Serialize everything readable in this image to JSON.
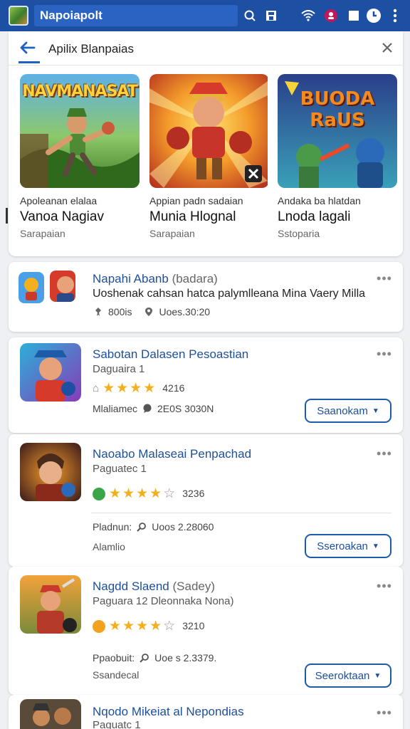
{
  "statusbar": {
    "title": "Napoiapolt",
    "icons": [
      "search-circle-icon",
      "save-icon",
      "wifi-icon",
      "notification-icon",
      "square-icon",
      "clock-icon",
      "more-vertical-icon"
    ]
  },
  "search": {
    "query": "Apilix Blanpaias",
    "back_icon": "arrow-left-icon",
    "clear_icon": "close-icon"
  },
  "featured": [
    {
      "image_text": "NAVMANASAT",
      "caption": "Apoleanan elalaa",
      "title": "Vanoa Nagiav",
      "subtitle": "Sarapaian"
    },
    {
      "image_text": "",
      "caption": "Appian padn sadaian",
      "title": "Munia Hlognal",
      "subtitle": "Sarapaian"
    },
    {
      "image_text": "BUODA RaUS",
      "caption": "Andaka ba hlatdan",
      "title": "Lnoda lagali",
      "subtitle": "Sstoparia"
    }
  ],
  "apps": [
    {
      "title": "Napahi Abanb",
      "title_suffix": "(badara)",
      "description": "Uoshenak cahsan hatca palymlleana Mina Vaery Milla",
      "meta1": "800is",
      "meta2": "Uoes.30:20"
    },
    {
      "title": "Sabotan Dalasen Pesoastian",
      "line1": "Daguaira 1",
      "stars": 4,
      "rating": "4216",
      "meta1_label": "Mlaliamec",
      "meta1_value": "2E0S 3030N",
      "button": "Saanokam"
    },
    {
      "title": "Naoabo Malaseai Penpachad",
      "line1": "Paguatec 1",
      "stars": 4,
      "rating": "3236",
      "detail_label": "Pladnun:",
      "detail_value": "Uoos 2.28060",
      "detail_line2": "Alamlio",
      "button": "Sseroakan"
    },
    {
      "title": "Nagdd Slaend",
      "title_suffix": "(Sadey)",
      "line1": "Paguara 12 Dleonnaka Nona)",
      "stars": 4,
      "rating": "3210",
      "detail_label": "Ppaobuit:",
      "detail_value": "Uoe s 2.3379.",
      "detail_line2": "Ssandecal",
      "button": "Seeroktaan"
    },
    {
      "title": "Nqodo Mikeiat al Nepondias",
      "line1": "Paguatc 1"
    }
  ],
  "colors": {
    "statusbar": "#1d4fa3",
    "accent": "#1d4f9a",
    "star": "#f2b01e",
    "background": "#eef0f3"
  }
}
